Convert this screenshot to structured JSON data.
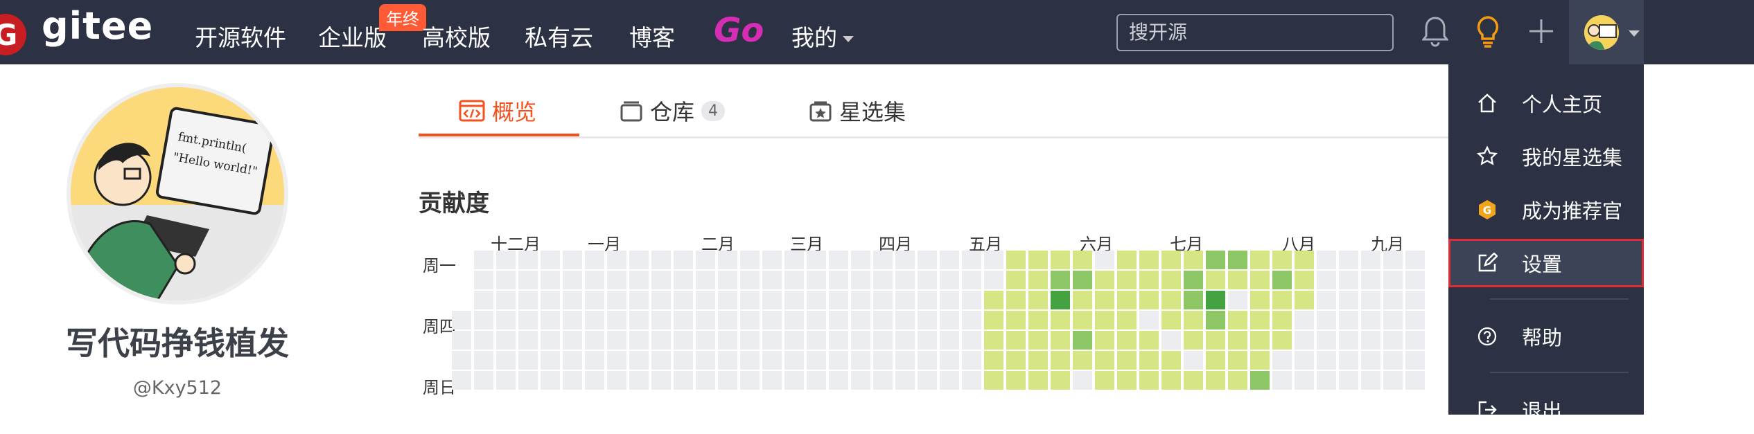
{
  "brand": {
    "logo_letter": "G",
    "name": "gitee"
  },
  "nav": {
    "items": [
      "开源软件",
      "企业版",
      "高校版",
      "私有云",
      "博客"
    ],
    "badge": "年终",
    "go_logo": "Go",
    "mine": "我的"
  },
  "search": {
    "placeholder": "搜开源",
    "value": ""
  },
  "topbar_icons": [
    "bell-icon",
    "lightbulb-icon",
    "plus-icon",
    "avatar"
  ],
  "tabs": {
    "overview": "概览",
    "repos": "仓库",
    "repos_count": "4",
    "stars": "星选集"
  },
  "profile": {
    "name": "写代码挣钱植发",
    "handle": "@Kxy512",
    "avatar_note_line1": "fmt.println(",
    "avatar_note_line2": "\"Hello world!\""
  },
  "contribution": {
    "title": "贡献度",
    "months": [
      "十二月",
      "一月",
      "二月",
      "三月",
      "四月",
      "五月",
      "六月",
      "七月",
      "八月",
      "九月"
    ],
    "weekdays": [
      "周一",
      "周四",
      "周日"
    ]
  },
  "dropdown": {
    "items": [
      "个人主页",
      "我的星选集",
      "成为推荐官",
      "设置",
      "帮助",
      "退出"
    ],
    "highlighted": "设置"
  },
  "colors": {
    "topbar": "#2c3143",
    "accent": "#f4511e",
    "level0": "#ebedf0",
    "level1": "#d6e685",
    "level2": "#8cc665",
    "level3": "#44a340",
    "level4": "#1e6823"
  }
}
